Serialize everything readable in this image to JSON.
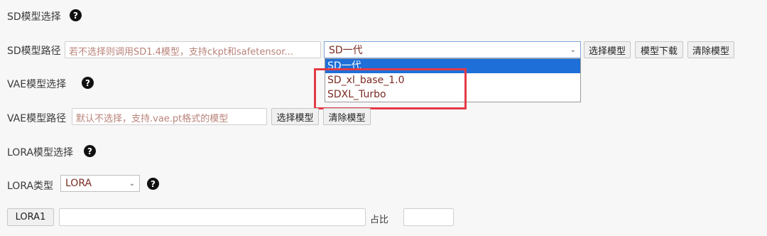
{
  "sd_section": {
    "title": "SD模型选择",
    "help": "?"
  },
  "sd_path": {
    "label": "SD模型路径",
    "placeholder": "若不选择则调用SD1.4模型，支持ckpt和safetensor...",
    "selected": "SD一代",
    "options": [
      "SD一代",
      "SD_xl_base_1.0",
      "SDXL_Turbo"
    ],
    "buttons": {
      "choose": "选择模型",
      "download": "模型下载",
      "clear": "清除模型"
    }
  },
  "vae_section": {
    "title": "VAE模型选择",
    "help": "?"
  },
  "vae_path": {
    "label": "VAE模型路径",
    "placeholder": "默认不选择，支持.vae.pt格式的模型",
    "buttons": {
      "choose": "选择模型",
      "clear": "清除模型"
    }
  },
  "lora_section": {
    "title": "LORA模型选择",
    "help": "?"
  },
  "lora_type": {
    "label": "LORA类型",
    "selected": "LORA",
    "help": "?"
  },
  "lora1": {
    "button": "LORA1",
    "ratio_label": "占比",
    "name_value": "",
    "ratio_value": ""
  },
  "colors": {
    "highlight_box": "#e43a46",
    "selected_option": "#1e6fd8"
  }
}
